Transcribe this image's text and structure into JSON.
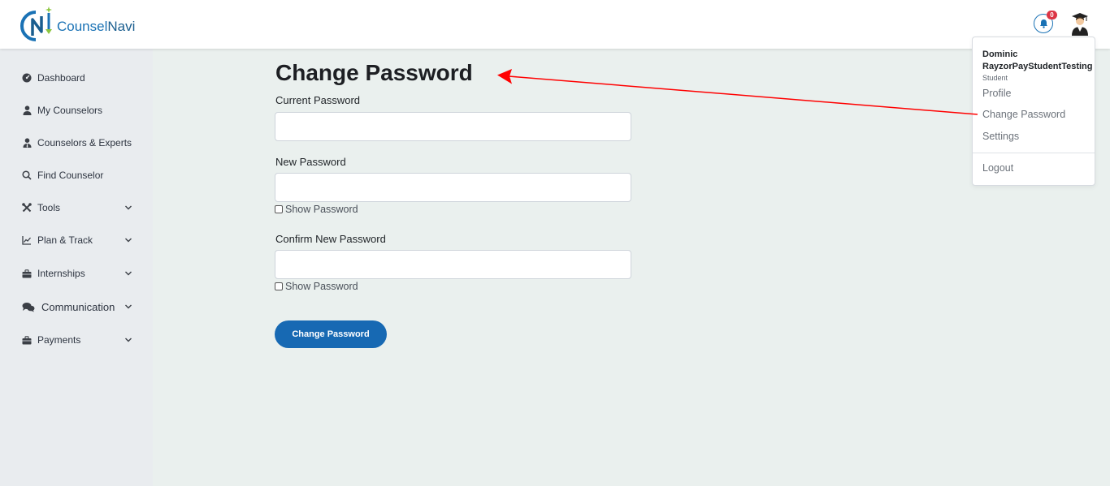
{
  "brand": {
    "logo_text_prefix": "Counsel",
    "logo_text_suffix": "Navi",
    "brand_color": "#1a72b5"
  },
  "header": {
    "notification_count": "0",
    "notification_icon": "bell-icon",
    "avatar_icon": "graduate-avatar-icon"
  },
  "sidebar": {
    "items": [
      {
        "label": "Dashboard",
        "icon": "dashboard-icon"
      },
      {
        "label": "My Counselors",
        "icon": "user-icon"
      },
      {
        "label": "Counselors & Experts",
        "icon": "user-tie-icon"
      },
      {
        "label": "Find Counselor",
        "icon": "search-icon"
      },
      {
        "label": "Tools",
        "icon": "tools-icon",
        "expandable": true
      },
      {
        "label": "Plan & Track",
        "icon": "chart-line-icon",
        "expandable": true
      },
      {
        "label": "Internships",
        "icon": "briefcase-icon",
        "expandable": true
      },
      {
        "label": "Communication",
        "icon": "comments-icon",
        "expandable": true
      },
      {
        "label": "Payments",
        "icon": "briefcase-icon",
        "expandable": true
      }
    ]
  },
  "form": {
    "title": "Change Password",
    "current_label": "Current Password",
    "current_value": "",
    "new_label": "New Password",
    "new_value": "",
    "show_password_new": "Show Password",
    "confirm_label": "Confirm New Password",
    "confirm_value": "",
    "show_password_confirm": "Show Password",
    "submit_label": "Change Password",
    "submit_color": "#1769b3"
  },
  "user_menu": {
    "name": "Dominic RayzorPayStudentTesting",
    "role": "Student",
    "items": [
      "Profile",
      "Change Password",
      "Settings"
    ],
    "logout_label": "Logout"
  },
  "annotation": {
    "arrow_color": "#ff0000"
  }
}
